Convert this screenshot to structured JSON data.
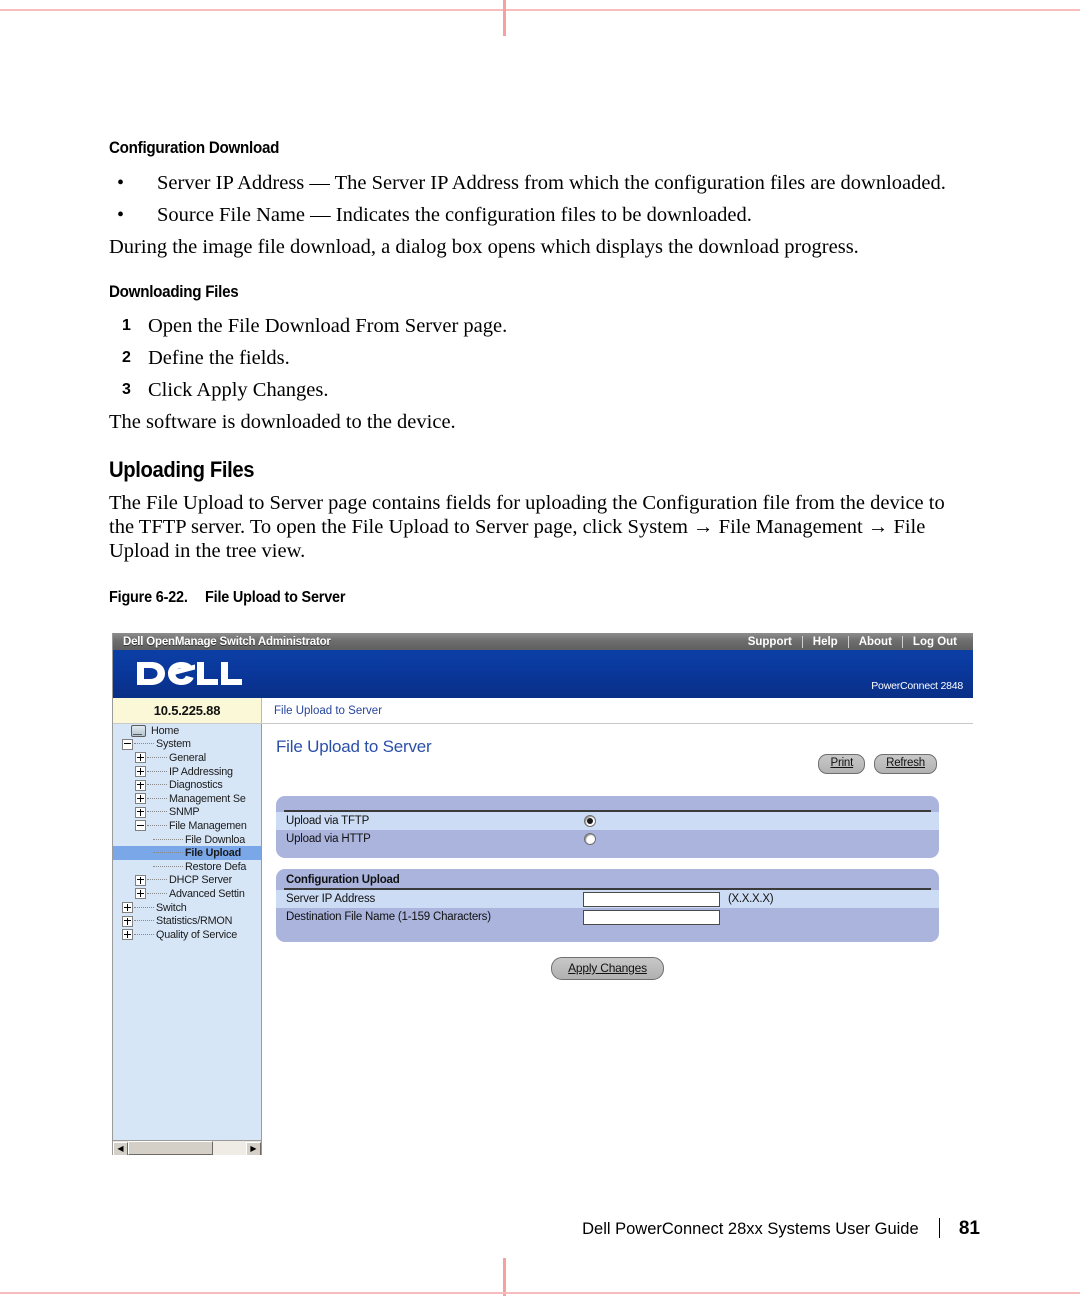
{
  "document": {
    "sections": [
      {
        "heading": "Configuration Download"
      },
      {
        "heading": "Downloading Files"
      },
      {
        "heading": "Uploading Files"
      }
    ],
    "config_download_bullets": [
      "Server IP Address — The Server IP Address from which the configuration files are downloaded.",
      "Source File Name — Indicates the configuration files to be downloaded."
    ],
    "download_note": "During the image file download, a dialog box opens which displays the download progress.",
    "downloading_steps": [
      {
        "num": "1",
        "text": "Open the File Download From Server page."
      },
      {
        "num": "2",
        "text": "Define the fields."
      },
      {
        "num": "3",
        "text": "Click Apply Changes."
      }
    ],
    "downloading_result": "The software is downloaded to the device.",
    "uploading_paragraph": "The File Upload to Server page contains fields for uploading the Configuration file from the device to the TFTP server. To open the File Upload to Server page, click System → File Management → File Upload in the tree view.",
    "figure_number": "Figure 6-22.",
    "figure_title": "File Upload to Server"
  },
  "footer": {
    "guide_title": "Dell PowerConnect 28xx Systems User Guide",
    "page_number": "81"
  },
  "app": {
    "titlebar": {
      "title": "Dell OpenManage Switch Administrator",
      "links": [
        "Support",
        "Help",
        "About",
        "Log Out"
      ]
    },
    "brand": {
      "logo_text": "DELL",
      "model": "PowerConnect 2848"
    },
    "ipbar": {
      "ip_address": "10.5.225.88",
      "breadcrumb": "File Upload to Server"
    },
    "tree": [
      {
        "label": "Home",
        "indent": 0,
        "toggle": "none",
        "icon": "home-icon",
        "selected": false
      },
      {
        "label": "System",
        "indent": 1,
        "toggle": "minus",
        "icon": "",
        "selected": false
      },
      {
        "label": "General",
        "indent": 2,
        "toggle": "plus",
        "icon": "",
        "selected": false
      },
      {
        "label": "IP Addressing",
        "indent": 2,
        "toggle": "plus",
        "icon": "",
        "selected": false
      },
      {
        "label": "Diagnostics",
        "indent": 2,
        "toggle": "plus",
        "icon": "",
        "selected": false
      },
      {
        "label": "Management Se",
        "indent": 2,
        "toggle": "plus",
        "icon": "",
        "selected": false
      },
      {
        "label": "SNMP",
        "indent": 2,
        "toggle": "plus",
        "icon": "",
        "selected": false
      },
      {
        "label": "File Managemen",
        "indent": 2,
        "toggle": "minus",
        "icon": "",
        "selected": false
      },
      {
        "label": "File Downloa",
        "indent": 3,
        "toggle": "leaf",
        "icon": "",
        "selected": false
      },
      {
        "label": "File Upload",
        "indent": 3,
        "toggle": "leaf",
        "icon": "",
        "selected": true
      },
      {
        "label": "Restore Defa",
        "indent": 3,
        "toggle": "leaf",
        "icon": "",
        "selected": false
      },
      {
        "label": "DHCP Server",
        "indent": 2,
        "toggle": "plus",
        "icon": "",
        "selected": false
      },
      {
        "label": "Advanced Settin",
        "indent": 2,
        "toggle": "plus",
        "icon": "",
        "selected": false
      },
      {
        "label": "Switch",
        "indent": 1,
        "toggle": "plus",
        "icon": "",
        "selected": false
      },
      {
        "label": "Statistics/RMON",
        "indent": 1,
        "toggle": "plus",
        "icon": "",
        "selected": false
      },
      {
        "label": "Quality of Service",
        "indent": 1,
        "toggle": "plus",
        "icon": "",
        "selected": false
      }
    ],
    "content": {
      "page_title": "File Upload to Server",
      "print_label": "Print",
      "refresh_label": "Refresh",
      "upload_method": {
        "rows": [
          {
            "label": "Upload via TFTP",
            "selected": true
          },
          {
            "label": "Upload via HTTP",
            "selected": false
          }
        ]
      },
      "configuration_upload": {
        "heading": "Configuration Upload",
        "server_ip_label": "Server IP Address",
        "server_ip_value": "",
        "server_ip_hint": "(X.X.X.X)",
        "dest_file_label": "Destination File Name (1-159 Characters)",
        "dest_file_value": ""
      },
      "apply_label": "Apply Changes"
    }
  },
  "colors": {
    "brand_blue": "#0a3698",
    "panel_blue": "#aab4dd",
    "row_alt": "#ccdcf4",
    "tree_bg": "#d7e6f7",
    "tree_selected": "#7aa7e8",
    "ip_yellow": "#fbf8d8",
    "link_blue": "#26459c",
    "crop_mark": "#f6a0a0"
  }
}
